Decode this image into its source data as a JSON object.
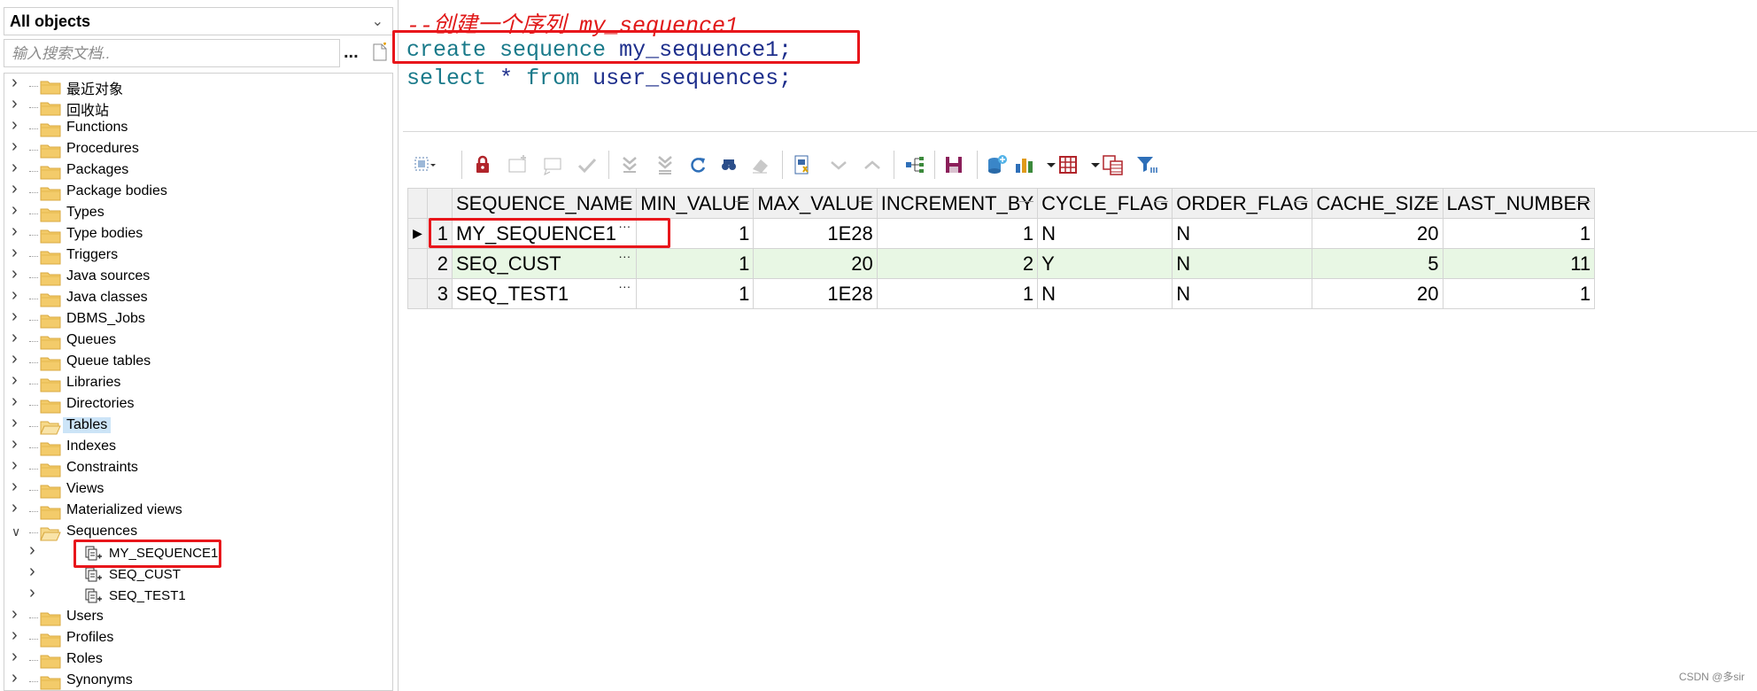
{
  "left_panel": {
    "object_selector": "All objects",
    "search_placeholder": "输入搜索文档..",
    "more_label": "...",
    "tree": [
      {
        "label": "最近对象"
      },
      {
        "label": "回收站"
      },
      {
        "label": "Functions"
      },
      {
        "label": "Procedures"
      },
      {
        "label": "Packages"
      },
      {
        "label": "Package bodies"
      },
      {
        "label": "Types"
      },
      {
        "label": "Type bodies"
      },
      {
        "label": "Triggers"
      },
      {
        "label": "Java sources"
      },
      {
        "label": "Java classes"
      },
      {
        "label": "DBMS_Jobs"
      },
      {
        "label": "Queues"
      },
      {
        "label": "Queue tables"
      },
      {
        "label": "Libraries"
      },
      {
        "label": "Directories"
      },
      {
        "label": "Tables"
      },
      {
        "label": "Indexes"
      },
      {
        "label": "Constraints"
      },
      {
        "label": "Views"
      },
      {
        "label": "Materialized views"
      },
      {
        "label": "Sequences"
      },
      {
        "label": "MY_SEQUENCE1"
      },
      {
        "label": "SEQ_CUST"
      },
      {
        "label": "SEQ_TEST1"
      },
      {
        "label": "Users"
      },
      {
        "label": "Profiles"
      },
      {
        "label": "Roles"
      },
      {
        "label": "Synonyms"
      }
    ]
  },
  "editor": {
    "comment": "--创建一个序列 my_sequence1",
    "line1": {
      "kw1": "create",
      "kw2": "sequence",
      "id": "my_sequence1",
      "end": ";"
    },
    "line2": {
      "kw1": "select",
      "star": "*",
      "kw2": "from",
      "id": "user_sequences",
      "end": ";"
    }
  },
  "grid": {
    "columns": [
      "SEQUENCE_NAME",
      "MIN_VALUE",
      "MAX_VALUE",
      "INCREMENT_BY",
      "CYCLE_FLAG",
      "ORDER_FLAG",
      "CACHE_SIZE",
      "LAST_NUMBER"
    ],
    "rows": [
      {
        "rn": "1",
        "cells": [
          "MY_SEQUENCE1",
          "1",
          "1E28",
          "1",
          "N",
          "N",
          "20",
          "1"
        ]
      },
      {
        "rn": "2",
        "cells": [
          "SEQ_CUST",
          "1",
          "20",
          "2",
          "Y",
          "N",
          "5",
          "11"
        ]
      },
      {
        "rn": "3",
        "cells": [
          "SEQ_TEST1",
          "1",
          "1E28",
          "1",
          "N",
          "N",
          "20",
          "1"
        ]
      }
    ],
    "cell_more": "···",
    "current_row_marker": "▶"
  },
  "watermark": "CSDN @多sir",
  "colors": {
    "highlight": "#e8161b",
    "keyword": "#1a7a8a",
    "identifier": "#1e2f8c",
    "comment": "#e01818",
    "alt_row": "#e8f7e4"
  }
}
